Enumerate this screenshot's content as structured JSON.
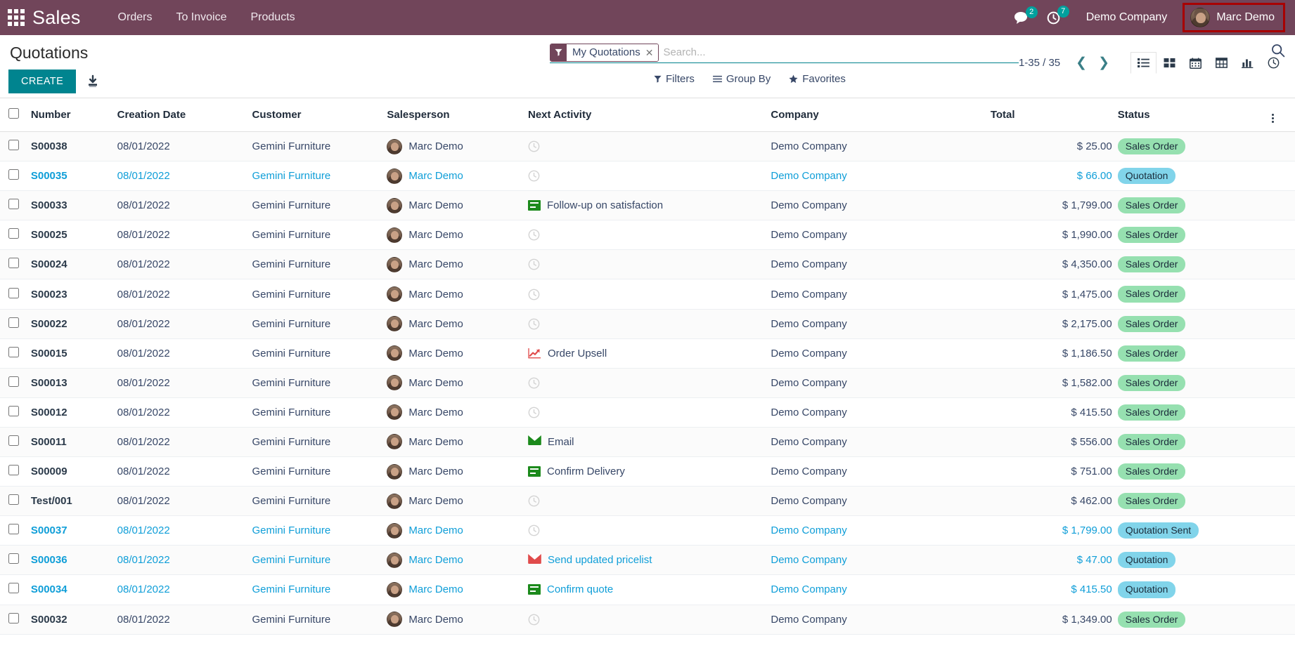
{
  "navbar": {
    "apps_icon": "apps-grid-icon",
    "brand": "Sales",
    "menu": [
      {
        "label": "Orders"
      },
      {
        "label": "To Invoice"
      },
      {
        "label": "Products"
      }
    ],
    "messages_icon": "comment-icon",
    "messages_count": "2",
    "activities_icon": "clock-icon",
    "activities_count": "7",
    "company": "Demo Company",
    "user": "Marc Demo",
    "user_avatar": "avatar-icon",
    "highlight_color": "#a80000",
    "bg_color": "#71455a"
  },
  "control_panel": {
    "title": "Quotations",
    "create_label": "CREATE",
    "import_icon": "download-import-icon",
    "search": {
      "facet_icon": "filter-icon",
      "facet_label": "My Quotations",
      "facet_remove_icon": "close-icon",
      "placeholder": "Search..."
    },
    "search_magnifier_icon": "search-icon",
    "filters": [
      {
        "label": "Filters",
        "icon": "filter-icon"
      },
      {
        "label": "Group By",
        "icon": "list-lines-icon"
      },
      {
        "label": "Favorites",
        "icon": "star-icon"
      }
    ],
    "pager": "1-35 / 35",
    "prev_icon": "chevron-left-icon",
    "next_icon": "chevron-right-icon",
    "views": [
      {
        "name": "list",
        "icon": "list-view-icon",
        "active": true
      },
      {
        "name": "kanban",
        "icon": "kanban-view-icon",
        "active": false
      },
      {
        "name": "calendar",
        "icon": "calendar-view-icon",
        "active": false
      },
      {
        "name": "pivot",
        "icon": "pivot-view-icon",
        "active": false
      },
      {
        "name": "graph",
        "icon": "graph-view-icon",
        "active": false
      },
      {
        "name": "activity",
        "icon": "activity-clock-view-icon",
        "active": false
      }
    ]
  },
  "table": {
    "columns": [
      "Number",
      "Creation Date",
      "Customer",
      "Salesperson",
      "Next Activity",
      "Company",
      "Total",
      "Status"
    ],
    "optional_columns_icon": "vertical-dots-icon",
    "rows": [
      {
        "number": "S00038",
        "date": "08/01/2022",
        "customer": "Gemini Furniture",
        "salesperson": "Marc Demo",
        "activity": "",
        "activity_icon": "clock-icon",
        "company": "Demo Company",
        "total": "$ 25.00",
        "status": "Sales Order",
        "status_type": "sales-order",
        "link": false
      },
      {
        "number": "S00035",
        "date": "08/01/2022",
        "customer": "Gemini Furniture",
        "salesperson": "Marc Demo",
        "activity": "",
        "activity_icon": "clock-icon",
        "company": "Demo Company",
        "total": "$ 66.00",
        "status": "Quotation",
        "status_type": "quotation",
        "link": true
      },
      {
        "number": "S00033",
        "date": "08/01/2022",
        "customer": "Gemini Furniture",
        "salesperson": "Marc Demo",
        "activity": "Follow-up on satisfaction",
        "activity_icon": "todo-green-icon",
        "company": "Demo Company",
        "total": "$ 1,799.00",
        "status": "Sales Order",
        "status_type": "sales-order",
        "link": false
      },
      {
        "number": "S00025",
        "date": "08/01/2022",
        "customer": "Gemini Furniture",
        "salesperson": "Marc Demo",
        "activity": "",
        "activity_icon": "clock-icon",
        "company": "Demo Company",
        "total": "$ 1,990.00",
        "status": "Sales Order",
        "status_type": "sales-order",
        "link": false
      },
      {
        "number": "S00024",
        "date": "08/01/2022",
        "customer": "Gemini Furniture",
        "salesperson": "Marc Demo",
        "activity": "",
        "activity_icon": "clock-icon",
        "company": "Demo Company",
        "total": "$ 4,350.00",
        "status": "Sales Order",
        "status_type": "sales-order",
        "link": false
      },
      {
        "number": "S00023",
        "date": "08/01/2022",
        "customer": "Gemini Furniture",
        "salesperson": "Marc Demo",
        "activity": "",
        "activity_icon": "clock-icon",
        "company": "Demo Company",
        "total": "$ 1,475.00",
        "status": "Sales Order",
        "status_type": "sales-order",
        "link": false
      },
      {
        "number": "S00022",
        "date": "08/01/2022",
        "customer": "Gemini Furniture",
        "salesperson": "Marc Demo",
        "activity": "",
        "activity_icon": "clock-icon",
        "company": "Demo Company",
        "total": "$ 2,175.00",
        "status": "Sales Order",
        "status_type": "sales-order",
        "link": false
      },
      {
        "number": "S00015",
        "date": "08/01/2022",
        "customer": "Gemini Furniture",
        "salesperson": "Marc Demo",
        "activity": "Order Upsell",
        "activity_icon": "upsell-chart-icon",
        "company": "Demo Company",
        "total": "$ 1,186.50",
        "status": "Sales Order",
        "status_type": "sales-order",
        "link": false
      },
      {
        "number": "S00013",
        "date": "08/01/2022",
        "customer": "Gemini Furniture",
        "salesperson": "Marc Demo",
        "activity": "",
        "activity_icon": "clock-icon",
        "company": "Demo Company",
        "total": "$ 1,582.00",
        "status": "Sales Order",
        "status_type": "sales-order",
        "link": false
      },
      {
        "number": "S00012",
        "date": "08/01/2022",
        "customer": "Gemini Furniture",
        "salesperson": "Marc Demo",
        "activity": "",
        "activity_icon": "clock-icon",
        "company": "Demo Company",
        "total": "$ 415.50",
        "status": "Sales Order",
        "status_type": "sales-order",
        "link": false
      },
      {
        "number": "S00011",
        "date": "08/01/2022",
        "customer": "Gemini Furniture",
        "salesperson": "Marc Demo",
        "activity": "Email",
        "activity_icon": "mail-green-icon",
        "company": "Demo Company",
        "total": "$ 556.00",
        "status": "Sales Order",
        "status_type": "sales-order",
        "link": false
      },
      {
        "number": "S00009",
        "date": "08/01/2022",
        "customer": "Gemini Furniture",
        "salesperson": "Marc Demo",
        "activity": "Confirm Delivery",
        "activity_icon": "todo-green-icon",
        "company": "Demo Company",
        "total": "$ 751.00",
        "status": "Sales Order",
        "status_type": "sales-order",
        "link": false
      },
      {
        "number": "Test/001",
        "date": "08/01/2022",
        "customer": "Gemini Furniture",
        "salesperson": "Marc Demo",
        "activity": "",
        "activity_icon": "clock-icon",
        "company": "Demo Company",
        "total": "$ 462.00",
        "status": "Sales Order",
        "status_type": "sales-order",
        "link": false
      },
      {
        "number": "S00037",
        "date": "08/01/2022",
        "customer": "Gemini Furniture",
        "salesperson": "Marc Demo",
        "activity": "",
        "activity_icon": "clock-icon",
        "company": "Demo Company",
        "total": "$ 1,799.00",
        "status": "Quotation Sent",
        "status_type": "quotation-sent",
        "link": true
      },
      {
        "number": "S00036",
        "date": "08/01/2022",
        "customer": "Gemini Furniture",
        "salesperson": "Marc Demo",
        "activity": "Send updated pricelist",
        "activity_icon": "mail-red-icon",
        "company": "Demo Company",
        "total": "$ 47.00",
        "status": "Quotation",
        "status_type": "quotation",
        "link": true
      },
      {
        "number": "S00034",
        "date": "08/01/2022",
        "customer": "Gemini Furniture",
        "salesperson": "Marc Demo",
        "activity": "Confirm quote",
        "activity_icon": "todo-green-icon",
        "company": "Demo Company",
        "total": "$ 415.50",
        "status": "Quotation",
        "status_type": "quotation",
        "link": true
      },
      {
        "number": "S00032",
        "date": "08/01/2022",
        "customer": "Gemini Furniture",
        "salesperson": "Marc Demo",
        "activity": "",
        "activity_icon": "clock-icon",
        "company": "Demo Company",
        "total": "$ 1,349.00",
        "status": "Sales Order",
        "status_type": "sales-order",
        "link": false
      }
    ]
  }
}
